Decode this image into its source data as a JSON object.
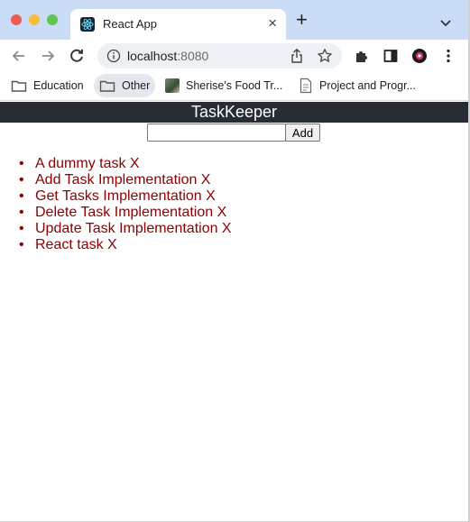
{
  "browser": {
    "tab": {
      "title": "React App",
      "close_label": "×"
    },
    "new_tab_label": "+",
    "omnibox": {
      "host": "localhost",
      "port": ":8080"
    },
    "bookmarks": [
      {
        "label": "Education",
        "icon": "folder-icon"
      },
      {
        "label": "Other",
        "icon": "folder-icon"
      },
      {
        "label": "Sherise's Food Tr...",
        "icon": "site-thumbnail-icon"
      },
      {
        "label": "Project and Progr...",
        "icon": "document-icon"
      }
    ]
  },
  "app": {
    "title": "TaskKeeper",
    "input": {
      "value": "",
      "placeholder": ""
    },
    "add_label": "Add",
    "tasks": [
      {
        "label": "A dummy task X"
      },
      {
        "label": "Add Task Implementation X"
      },
      {
        "label": "Get Tasks Implementation X"
      },
      {
        "label": "Delete Task Implementation X"
      },
      {
        "label": "Update Task Implementation X"
      },
      {
        "label": "React task X"
      }
    ]
  },
  "colors": {
    "header_bg": "#282c34",
    "task_text": "#8b0000",
    "tabstrip_bg": "#cadcf6"
  }
}
